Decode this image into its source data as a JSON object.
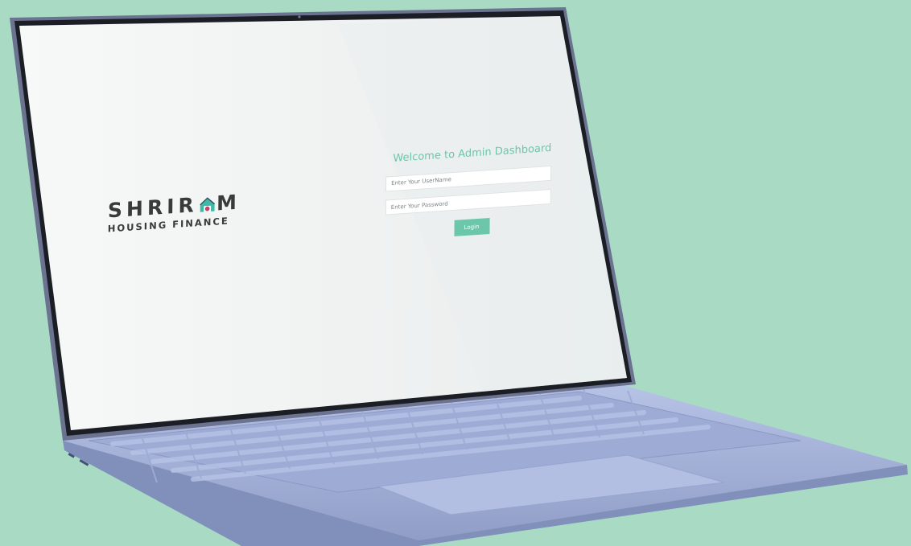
{
  "login": {
    "title": "Welcome to Admin Dashboard",
    "username_placeholder": "Enter Your UserName",
    "password_placeholder": "Enter Your Password",
    "button_label": "Login"
  },
  "logo": {
    "word_start": "SHRIR",
    "word_end": "M",
    "subtitle": "HOUSING FINANCE"
  },
  "colors": {
    "background": "#a9dbc4",
    "accent": "#6cc6aa",
    "laptop_body": "#a9b6dc"
  }
}
